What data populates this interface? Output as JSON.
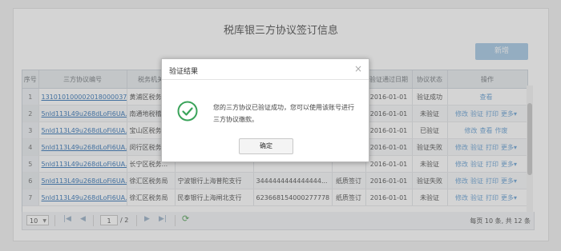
{
  "page": {
    "title": "税库银三方协议签订信息",
    "new_button": "新增"
  },
  "table": {
    "columns": [
      "序号",
      "三方协议编号",
      "税务机关",
      "",
      "",
      "",
      "验证通过日期",
      "协议状态",
      "操作"
    ],
    "rows": [
      {
        "no": "1",
        "code": "131010100002018000037",
        "org": "黄浦区税务...",
        "bank": "",
        "account": "",
        "type": "",
        "date": "2016-01-01",
        "status": "验证成功",
        "actions": [
          "查看"
        ]
      },
      {
        "no": "2",
        "code": "5nld113L49u268dLoFi6UA...",
        "org": "南通地税稽...",
        "bank": "",
        "account": "",
        "type": "",
        "date": "2016-01-01",
        "status": "未验证",
        "actions": [
          "修改",
          "验证",
          "打印",
          "更多▾"
        ]
      },
      {
        "no": "3",
        "code": "5nld113L49u268dLoFi6UA...",
        "org": "宝山区税务...",
        "bank": "",
        "account": "",
        "type": "",
        "date": "2016-01-01",
        "status": "已验证",
        "actions": [
          "修改",
          "查看",
          "作废"
        ]
      },
      {
        "no": "4",
        "code": "5nld113L49u268dLoFi6UA...",
        "org": "闵行区税务...",
        "bank": "",
        "account": "",
        "type": "",
        "date": "2016-01-01",
        "status": "验证失败",
        "actions": [
          "修改",
          "验证",
          "打印",
          "更多▾"
        ]
      },
      {
        "no": "5",
        "code": "5nld113L49u268dLoFi6UA...",
        "org": "长宁区税务...",
        "bank": "",
        "account": "",
        "type": "",
        "date": "2016-01-01",
        "status": "未验证",
        "actions": [
          "修改",
          "验证",
          "打印",
          "更多▾"
        ]
      },
      {
        "no": "6",
        "code": "5nld113L49u268dLoFi6UA...",
        "org": "徐汇区税务局",
        "bank": "宁波银行上海普陀支行",
        "account": "3444444444444444...",
        "type": "纸质签订",
        "date": "2016-01-01",
        "status": "验证失败",
        "actions": [
          "修改",
          "验证",
          "打印",
          "更多▾"
        ]
      },
      {
        "no": "7",
        "code": "5nld113L49u268dLoFi6UA...",
        "org": "徐汇区税务局",
        "bank": "民泰银行上海闸北支行",
        "account": "623668154000277778",
        "type": "纸质签订",
        "date": "2016-01-01",
        "status": "未验证",
        "actions": [
          "修改",
          "验证",
          "打印",
          "更多▾"
        ]
      }
    ]
  },
  "pager": {
    "page_size": "10",
    "current_page": "1",
    "total_pages": "/ 2",
    "info": "每页 10 条, 共 12 条"
  },
  "dialog": {
    "title": "验证结果",
    "close": "×",
    "message": "您的三方协议已验证成功，您可以使用该账号进行三方协议缴款。",
    "ok": "确定"
  },
  "icons": {
    "success": "check-circle-icon",
    "refresh": "refresh-icon"
  },
  "colors": {
    "accent": "#a9cbe6",
    "link": "#3a78b8",
    "success": "#3aa35a"
  }
}
